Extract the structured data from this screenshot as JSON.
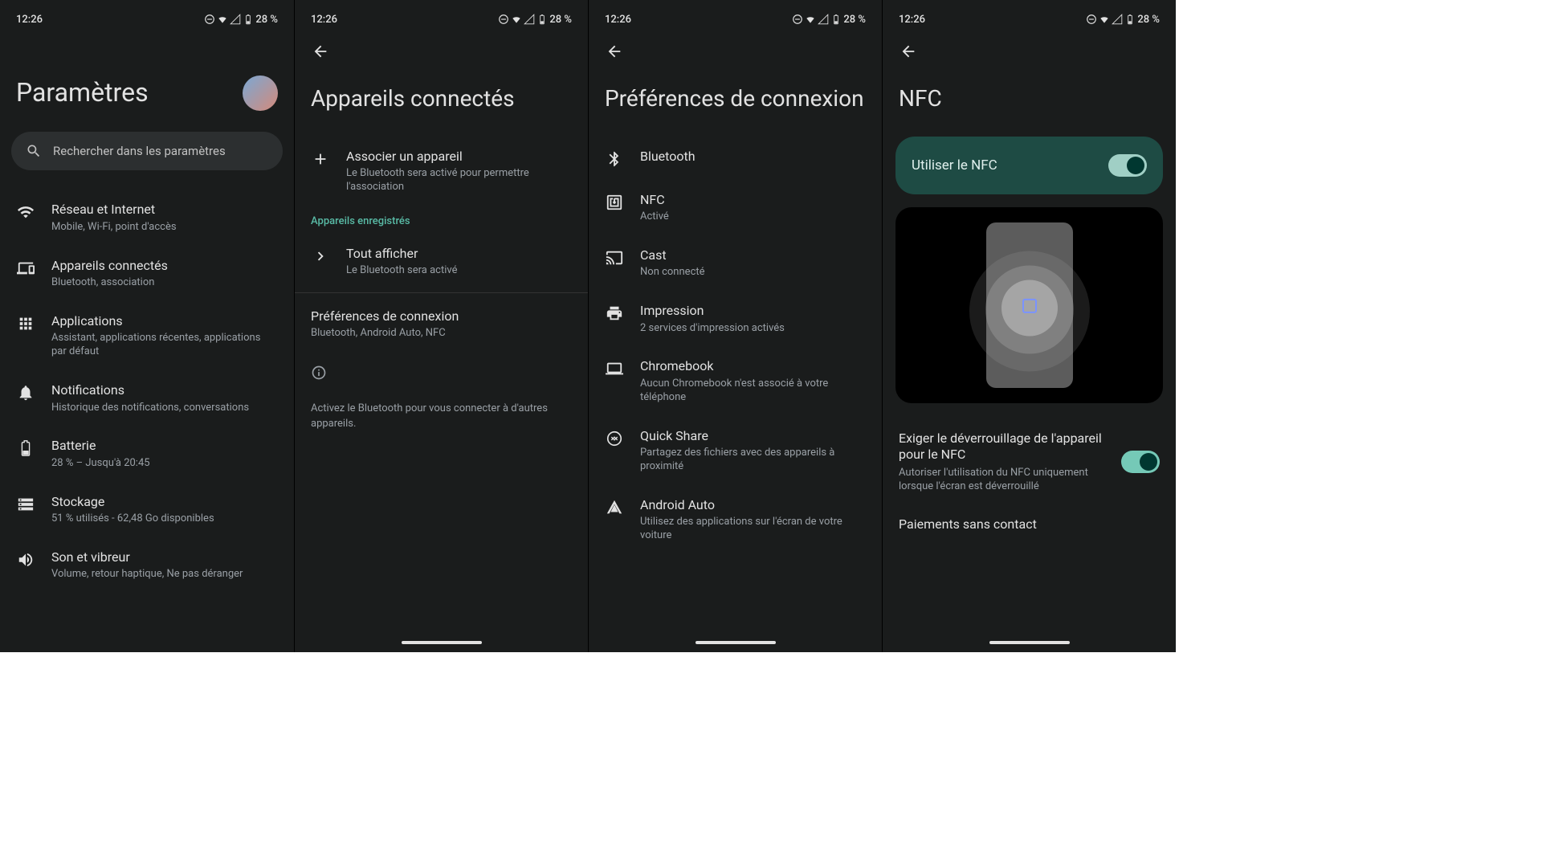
{
  "status": {
    "time": "12:26",
    "battery": "28 %"
  },
  "s1": {
    "title": "Paramètres",
    "search": "Rechercher dans les paramètres",
    "items": [
      {
        "title": "Réseau et Internet",
        "subtitle": "Mobile, Wi-Fi, point d'accès"
      },
      {
        "title": "Appareils connectés",
        "subtitle": "Bluetooth, association"
      },
      {
        "title": "Applications",
        "subtitle": "Assistant, applications récentes, applications par défaut"
      },
      {
        "title": "Notifications",
        "subtitle": "Historique des notifications, conversations"
      },
      {
        "title": "Batterie",
        "subtitle": "28 % – Jusqu'à 20:45"
      },
      {
        "title": "Stockage",
        "subtitle": "51 % utilisés - 62,48 Go disponibles"
      },
      {
        "title": "Son et vibreur",
        "subtitle": "Volume, retour haptique, Ne pas déranger"
      }
    ]
  },
  "s2": {
    "title": "Appareils connectés",
    "pair": {
      "title": "Associer un appareil",
      "subtitle": "Le Bluetooth sera activé pour permettre l'association"
    },
    "section": "Appareils enregistrés",
    "showall": {
      "title": "Tout afficher",
      "subtitle": "Le Bluetooth sera activé"
    },
    "prefs": {
      "title": "Préférences de connexion",
      "subtitle": "Bluetooth, Android Auto, NFC"
    },
    "info": "Activez le Bluetooth pour vous connecter à d'autres appareils."
  },
  "s3": {
    "title": "Préférences de connexion",
    "items": [
      {
        "title": "Bluetooth",
        "subtitle": ""
      },
      {
        "title": "NFC",
        "subtitle": "Activé"
      },
      {
        "title": "Cast",
        "subtitle": "Non connecté"
      },
      {
        "title": "Impression",
        "subtitle": "2 services d'impression activés"
      },
      {
        "title": "Chromebook",
        "subtitle": "Aucun Chromebook n'est associé à votre téléphone"
      },
      {
        "title": "Quick Share",
        "subtitle": "Partagez des fichiers avec des appareils à proximité"
      },
      {
        "title": "Android Auto",
        "subtitle": "Utilisez des applications sur l'écran de votre voiture"
      }
    ]
  },
  "s4": {
    "title": "NFC",
    "useNfc": "Utiliser le NFC",
    "unlock": {
      "title": "Exiger le déverrouillage de l'appareil pour le NFC",
      "subtitle": "Autoriser l'utilisation du NFC uniquement lorsque l'écran est déverrouillé"
    },
    "payments": "Paiements sans contact"
  }
}
